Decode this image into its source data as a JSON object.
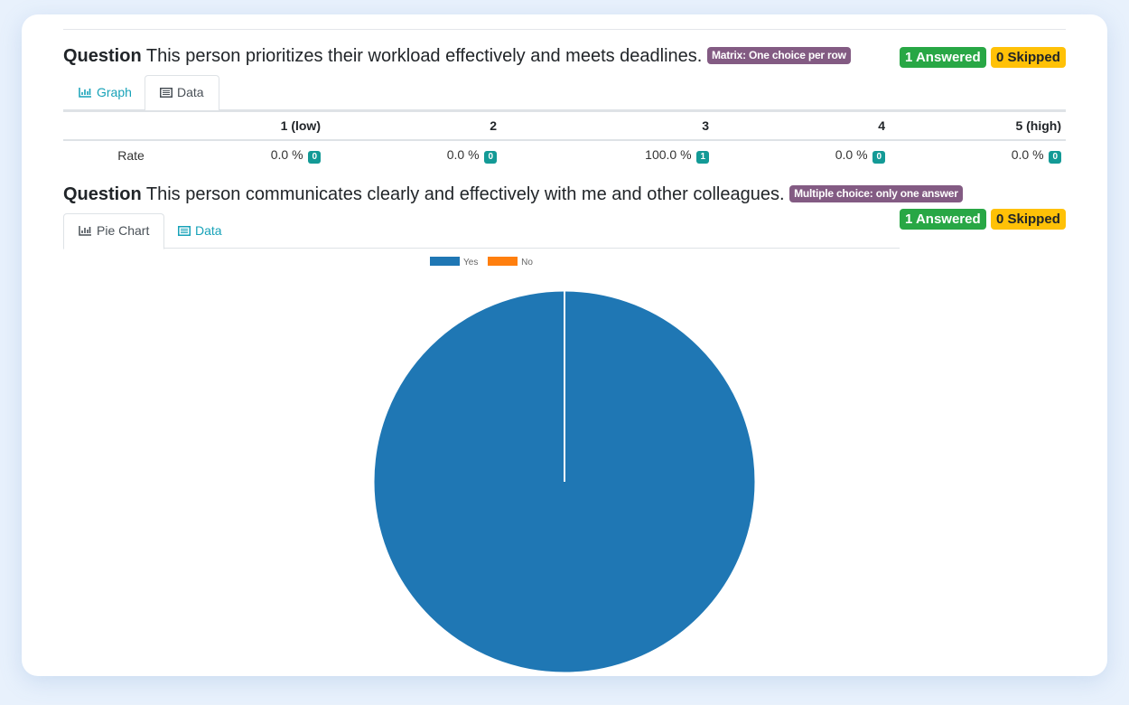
{
  "questions": [
    {
      "label": "Question",
      "text": "This person prioritizes their workload effectively and meets deadlines.",
      "type_badge": "Matrix: One choice per row",
      "answered": "1 Answered",
      "skipped": "0 Skipped",
      "tabs": [
        {
          "label": "Graph",
          "icon": "bar-chart-icon",
          "active": false
        },
        {
          "label": "Data",
          "icon": "table-list-icon",
          "active": true
        }
      ],
      "table": {
        "columns": [
          "",
          "1 (low)",
          "2",
          "3",
          "4",
          "5 (high)"
        ],
        "rows": [
          {
            "label": "Rate",
            "cells": [
              {
                "percent": "0.0 %",
                "count": "0"
              },
              {
                "percent": "0.0 %",
                "count": "0"
              },
              {
                "percent": "100.0 %",
                "count": "1"
              },
              {
                "percent": "0.0 %",
                "count": "0"
              },
              {
                "percent": "0.0 %",
                "count": "0"
              }
            ]
          }
        ]
      }
    },
    {
      "label": "Question",
      "text": "This person communicates clearly and effectively with me and other colleagues.",
      "type_badge": "Multiple choice: only one answer",
      "answered": "1 Answered",
      "skipped": "0 Skipped",
      "tabs": [
        {
          "label": "Pie Chart",
          "icon": "bar-chart-icon",
          "active": true
        },
        {
          "label": "Data",
          "icon": "table-list-icon",
          "active": false
        }
      ]
    }
  ],
  "colors": {
    "yes": "#1f77b4",
    "no": "#ff7f0e",
    "badge_type": "#835b83",
    "answered": "#28a745",
    "skipped": "#ffc107",
    "count_badge": "#139a96",
    "tab_link": "#17a2b8"
  },
  "chart_data": {
    "type": "pie",
    "title": "",
    "categories": [
      "Yes",
      "No"
    ],
    "values": [
      1,
      0
    ],
    "colors": [
      "#1f77b4",
      "#ff7f0e"
    ],
    "legend": [
      "Yes",
      "No"
    ],
    "legend_position": "top"
  }
}
